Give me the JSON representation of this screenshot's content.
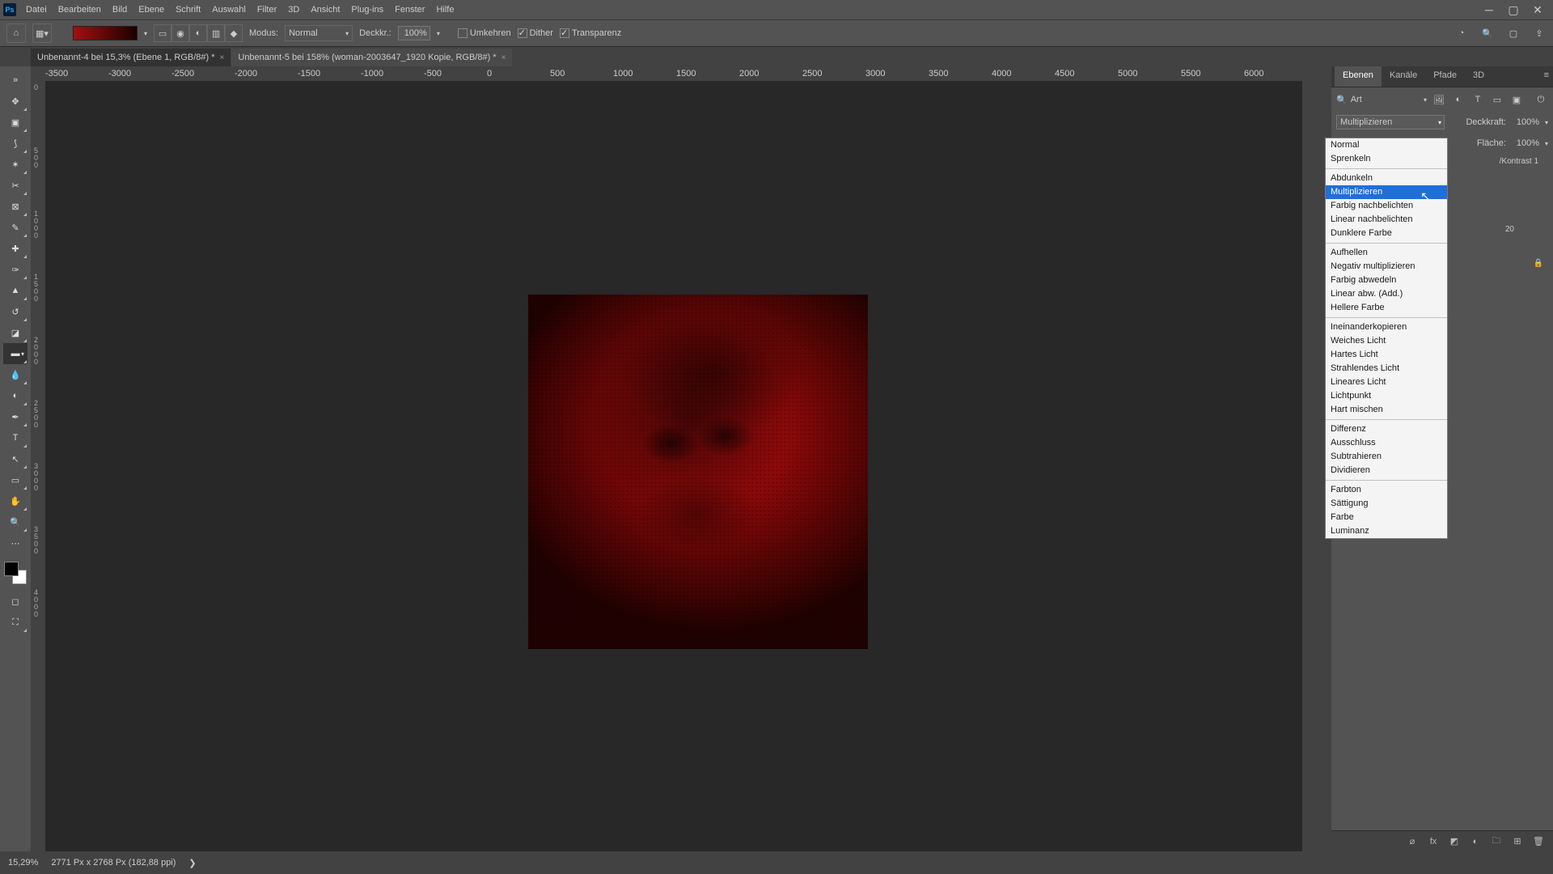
{
  "menu": {
    "items": [
      "Datei",
      "Bearbeiten",
      "Bild",
      "Ebene",
      "Schrift",
      "Auswahl",
      "Filter",
      "3D",
      "Ansicht",
      "Plug-ins",
      "Fenster",
      "Hilfe"
    ]
  },
  "optbar": {
    "modus_label": "Modus:",
    "modus_value": "Normal",
    "deckkraft_label": "Deckkr.:",
    "deckkraft_value": "100%",
    "umkehren": "Umkehren",
    "dither": "Dither",
    "transparenz": "Transparenz"
  },
  "tabs": [
    {
      "title": "Unbenannt-4 bei 15,3% (Ebene 1, RGB/8#) *"
    },
    {
      "title": "Unbenannt-5 bei 158% (woman-2003647_1920 Kopie, RGB/8#) *"
    }
  ],
  "ruler_h": [
    "-3500",
    "-3000",
    "-2500",
    "-2000",
    "-1500",
    "-1000",
    "-500",
    "0",
    "500",
    "1000",
    "1500",
    "2000",
    "2500",
    "3000",
    "3500",
    "4000",
    "4500",
    "5000",
    "5500",
    "6000"
  ],
  "ruler_v": [
    "0",
    "5 0 0",
    "1 0 0 0",
    "1 5 0 0",
    "2 0 0 0",
    "2 5 0 0",
    "3 0 0 0",
    "3 5 0 0",
    "4 0 0 0"
  ],
  "panels": {
    "tabs": [
      "Ebenen",
      "Kanäle",
      "Pfade",
      "3D"
    ],
    "search_label": "Art",
    "blend_value": "Multiplizieren",
    "deckkraft_label": "Deckkraft:",
    "deckkraft_value": "100%",
    "flaeche_label": "Fläche:",
    "flaeche_value": "100%",
    "layer_adj": "/Kontrast 1",
    "layer_n": "20"
  },
  "blend_modes": [
    [
      "Normal",
      "Sprenkeln"
    ],
    [
      "Abdunkeln",
      "Multiplizieren",
      "Farbig nachbelichten",
      "Linear nachbelichten",
      "Dunklere Farbe"
    ],
    [
      "Aufhellen",
      "Negativ multiplizieren",
      "Farbig abwedeln",
      "Linear abw. (Add.)",
      "Hellere Farbe"
    ],
    [
      "Ineinanderkopieren",
      "Weiches Licht",
      "Hartes Licht",
      "Strahlendes Licht",
      "Lineares Licht",
      "Lichtpunkt",
      "Hart mischen"
    ],
    [
      "Differenz",
      "Ausschluss",
      "Subtrahieren",
      "Dividieren"
    ],
    [
      "Farbton",
      "Sättigung",
      "Farbe",
      "Luminanz"
    ]
  ],
  "blend_highlight": "Multiplizieren",
  "status": {
    "zoom": "15,29%",
    "doc": "2771 Px x 2768 Px (182,88 ppi)",
    "chevron": "❯"
  }
}
